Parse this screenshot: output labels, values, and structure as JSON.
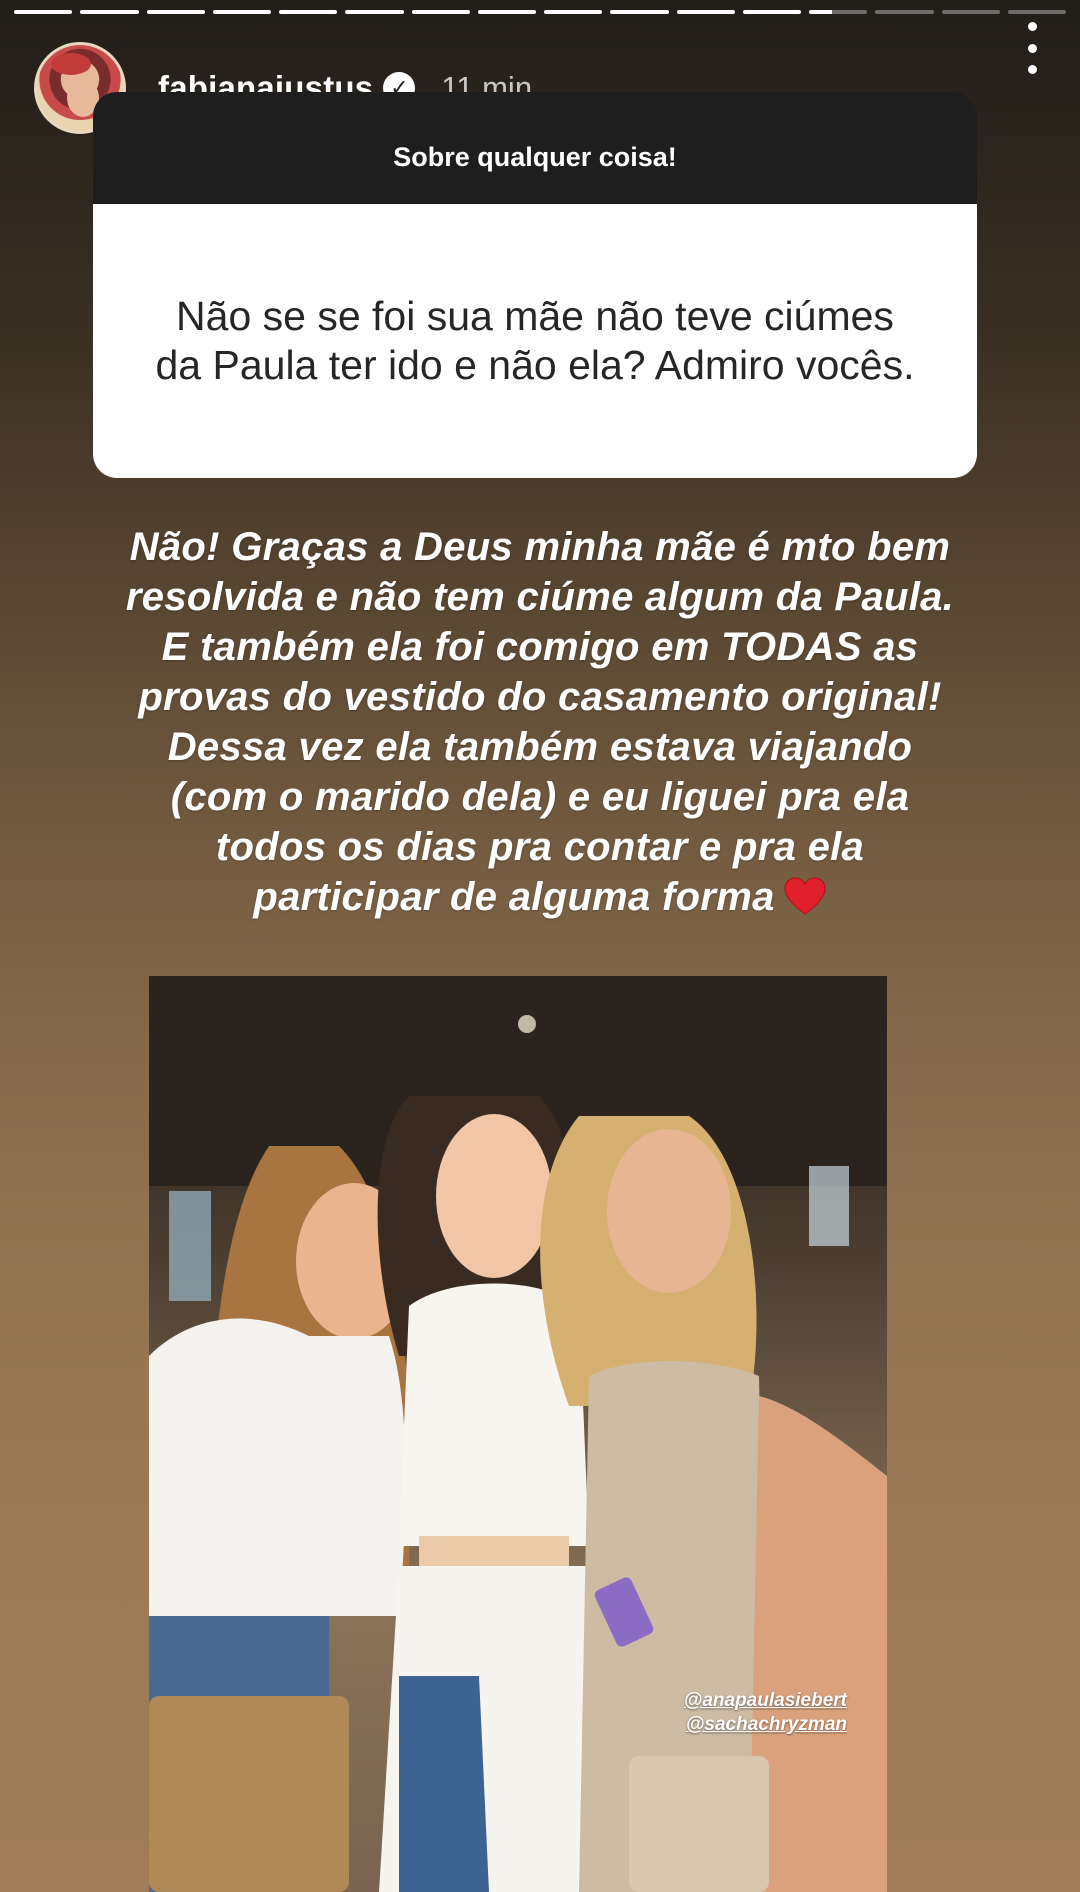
{
  "story": {
    "progress": {
      "total_segments": 16,
      "completed_segments": 12,
      "current_fraction": 0.4
    },
    "user": {
      "username": "fabianajustus",
      "verified_mark": "✓",
      "time_ago": "11 min"
    },
    "question_box": {
      "prompt": "Sobre qualquer coisa!",
      "question": "Não se se foi sua mãe não teve ciúmes da Paula ter ido e não ela? Admiro vocês."
    },
    "answer": {
      "lines": [
        "Não! Graças a Deus minha mãe é mto bem",
        "resolvida e não tem ciúme algum da Paula.",
        "E também ela foi comigo em TODAS as",
        "provas do vestido do casamento original!",
        "Dessa vez ela também estava viajando",
        "(com o marido dela) e eu liguei pra ela",
        "todos os dias pra contar e pra ela",
        "participar de alguma forma"
      ],
      "emoji": "heart-icon"
    },
    "photo": {
      "mentions": [
        "@anapaulasiebert",
        "@sachachryzman"
      ]
    },
    "icons": {
      "more": "more-vertical-icon",
      "verified": "verified-badge-icon"
    },
    "colors": {
      "heart": "#e0202a",
      "card_header": "#1e1e1e",
      "card_body": "#ffffff"
    }
  }
}
